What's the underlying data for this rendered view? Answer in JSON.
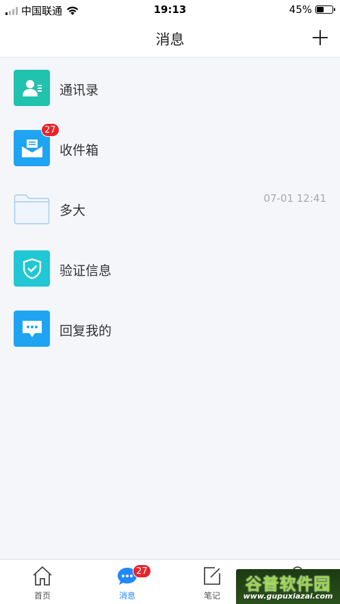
{
  "status_bar": {
    "carrier": "中国联通",
    "time": "19:13",
    "battery_percent_text": "45%",
    "battery_level": 0.45
  },
  "header": {
    "title": "消息",
    "add_icon": "plus-icon"
  },
  "list": [
    {
      "label": "通讯录",
      "icon": "contact-card-icon",
      "color": "#21c2ae"
    },
    {
      "label": "收件箱",
      "icon": "inbox-envelope-icon",
      "color": "#1ea4f3",
      "badge": "27"
    },
    {
      "label": "多大",
      "icon": "folder-icon",
      "color": "#a9cdea",
      "time": "07-01 12:41"
    },
    {
      "label": "验证信息",
      "icon": "shield-check-icon",
      "color": "#21c7d4"
    },
    {
      "label": "回复我的",
      "icon": "chat-bubble-icon",
      "color": "#1ea4f3"
    }
  ],
  "tabs": [
    {
      "label": "首页",
      "icon": "home-icon"
    },
    {
      "label": "消息",
      "icon": "message-icon",
      "badge": "27",
      "active": true
    },
    {
      "label": "笔记",
      "icon": "edit-note-icon"
    },
    {
      "label": "",
      "icon": "profile-icon"
    }
  ],
  "watermark": {
    "title": "谷普软件园",
    "url": "www.gupuxiazai.com"
  },
  "colors": {
    "accent": "#2188ff",
    "badge": "#e8232a"
  }
}
